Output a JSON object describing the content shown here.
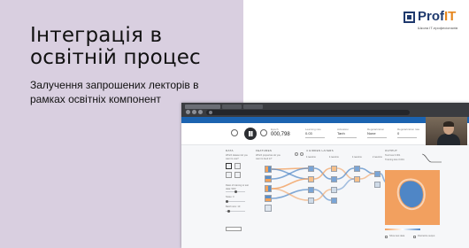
{
  "slide": {
    "title": "Інтеграція в освітній процес",
    "subtitle": "Залучення запрошених лекторів в рамках освітніх компонент"
  },
  "logo": {
    "brand_prefix": "Prof",
    "brand_suffix": "IT",
    "tagline": "Школа ІТ-професіоналів",
    "icon": "profit-logo-mark"
  },
  "shared_screen": {
    "controls": {
      "epoch_label": "Epoch",
      "epoch_value": "000,798",
      "learning_rate_label": "Learning rate",
      "learning_rate_value": "0.03",
      "activation_label": "Activation",
      "activation_value": "Tanh",
      "regularization_label": "Regularization",
      "regularization_value": "None",
      "reg_rate_label": "Regularization rate",
      "reg_rate_value": "0",
      "problem_label": "Problem type",
      "problem_value": "Classification"
    },
    "columns": {
      "data": "DATA",
      "features": "FEATURES",
      "hidden_layers": "4  HIDDEN LAYERS",
      "output": "OUTPUT"
    },
    "data_panel": {
      "which_dataset": "Which dataset do you want to use?",
      "ratio": "Ratio of training to test data: 50%",
      "noise": "Noise: 0",
      "batch": "Batch size: 10",
      "regenerate": "REGENERATE"
    },
    "features_panel": {
      "hint": "Which properties do you want to feed in?"
    },
    "hidden_layer_heads": [
      "4 neurons",
      "4 neurons",
      "4 neurons",
      "2 neurons"
    ],
    "output_panel": {
      "test_loss": "Test loss 0.001",
      "training_loss": "Training loss 0.001",
      "show_test_data": "Show test data",
      "discretize": "Discretize output"
    },
    "colors": {
      "orange": "#f2a05f",
      "blue": "#4f86c6",
      "header": "#1b63b0"
    }
  }
}
